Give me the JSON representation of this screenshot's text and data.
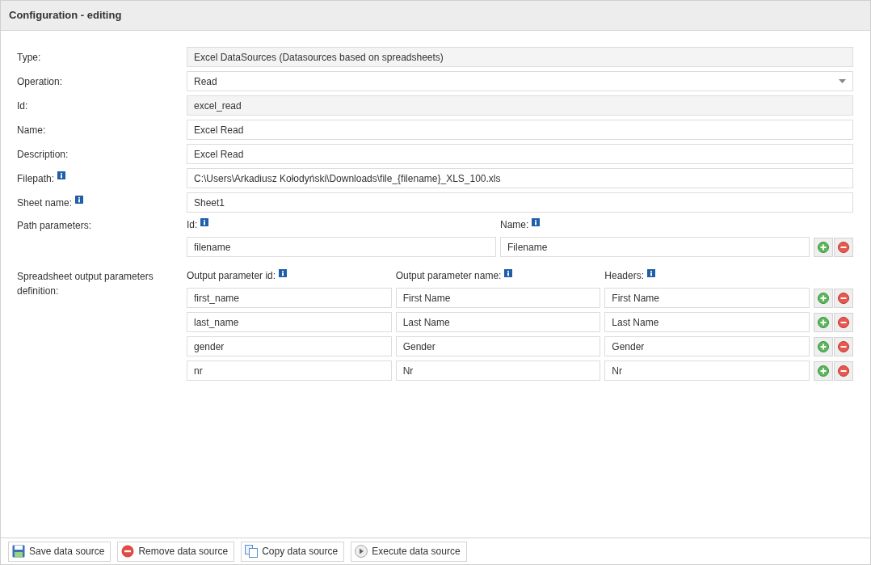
{
  "panel": {
    "title": "Configuration - editing"
  },
  "fields": [
    {
      "label": "Type:",
      "kind": "readonly",
      "info": false,
      "value": "Excel DataSources (Datasources based on spreadsheets)"
    },
    {
      "label": "Operation:",
      "kind": "select",
      "info": false,
      "value": "Read"
    },
    {
      "label": "Id:",
      "kind": "readonly",
      "info": false,
      "value": "excel_read"
    },
    {
      "label": "Name:",
      "kind": "text",
      "info": false,
      "value": "Excel Read"
    },
    {
      "label": "Description:",
      "kind": "text",
      "info": false,
      "value": "Excel Read"
    },
    {
      "label": "Filepath:",
      "kind": "text",
      "info": true,
      "value": "C:\\Users\\Arkadiusz Kołodyński\\Downloads\\file_{filename}_XLS_100.xls"
    },
    {
      "label": "Sheet name:",
      "kind": "text",
      "info": true,
      "value": "Sheet1"
    }
  ],
  "path_parameters": {
    "label": "Path parameters:",
    "columns": [
      {
        "label": "Id:",
        "info": true
      },
      {
        "label": "Name:",
        "info": true
      }
    ],
    "rows": [
      [
        "filename",
        "Filename"
      ]
    ]
  },
  "output_parameters": {
    "label": "Spreadsheet output parameters definition:",
    "columns": [
      {
        "label": "Output parameter id:",
        "info": true
      },
      {
        "label": "Output parameter name:",
        "info": true
      },
      {
        "label": "Headers:",
        "info": true
      }
    ],
    "rows": [
      [
        "first_name",
        "First Name",
        "First Name"
      ],
      [
        "last_name",
        "Last Name",
        "Last Name"
      ],
      [
        "gender",
        "Gender",
        "Gender"
      ],
      [
        "nr",
        "Nr",
        "Nr"
      ]
    ]
  },
  "toolbar": [
    {
      "kind": "save",
      "label": "Save data source"
    },
    {
      "kind": "remove",
      "label": "Remove data source"
    },
    {
      "kind": "copy",
      "label": "Copy data source"
    },
    {
      "kind": "execute",
      "label": "Execute data source"
    }
  ]
}
